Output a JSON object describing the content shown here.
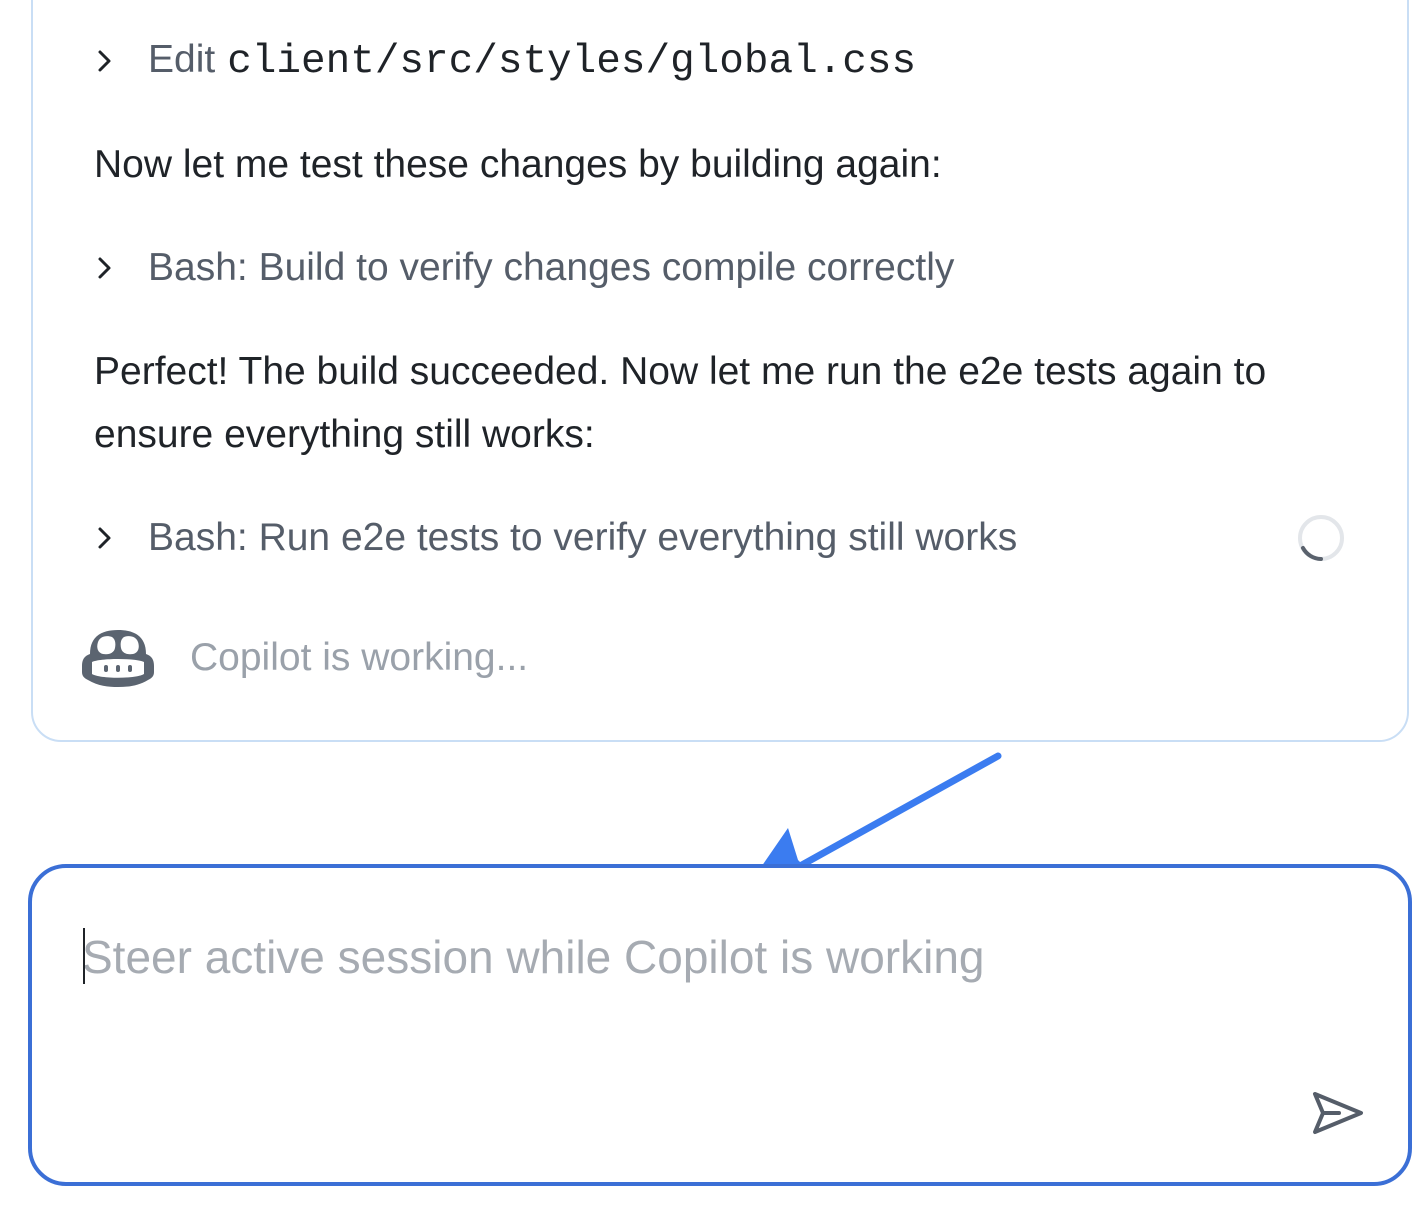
{
  "session": {
    "tool_calls": [
      {
        "verb": "Edit",
        "path": "client/src/styles/global.css"
      },
      {
        "label": "Bash: Build to verify changes compile correctly"
      },
      {
        "label": "Bash: Run e2e tests to verify everything still works",
        "status": "running"
      }
    ],
    "messages": [
      "Now let me test these changes by building again:",
      "Perfect! The build succeeded. Now let me run the e2e tests again to ensure everything still works:"
    ],
    "working_text": "Copilot is working..."
  },
  "steer": {
    "placeholder": "Steer active session while Copilot is working",
    "value": ""
  },
  "icons": {
    "chevron": "chevron-right-icon",
    "spinner": "loading-spinner-icon",
    "avatar": "copilot-icon",
    "send": "send-icon"
  },
  "colors": {
    "card_border": "#c9def5",
    "input_border": "#3b6fd6",
    "annotation_arrow": "#3b7cf0",
    "muted_text": "#555d69",
    "placeholder_text": "#a6abb2"
  }
}
